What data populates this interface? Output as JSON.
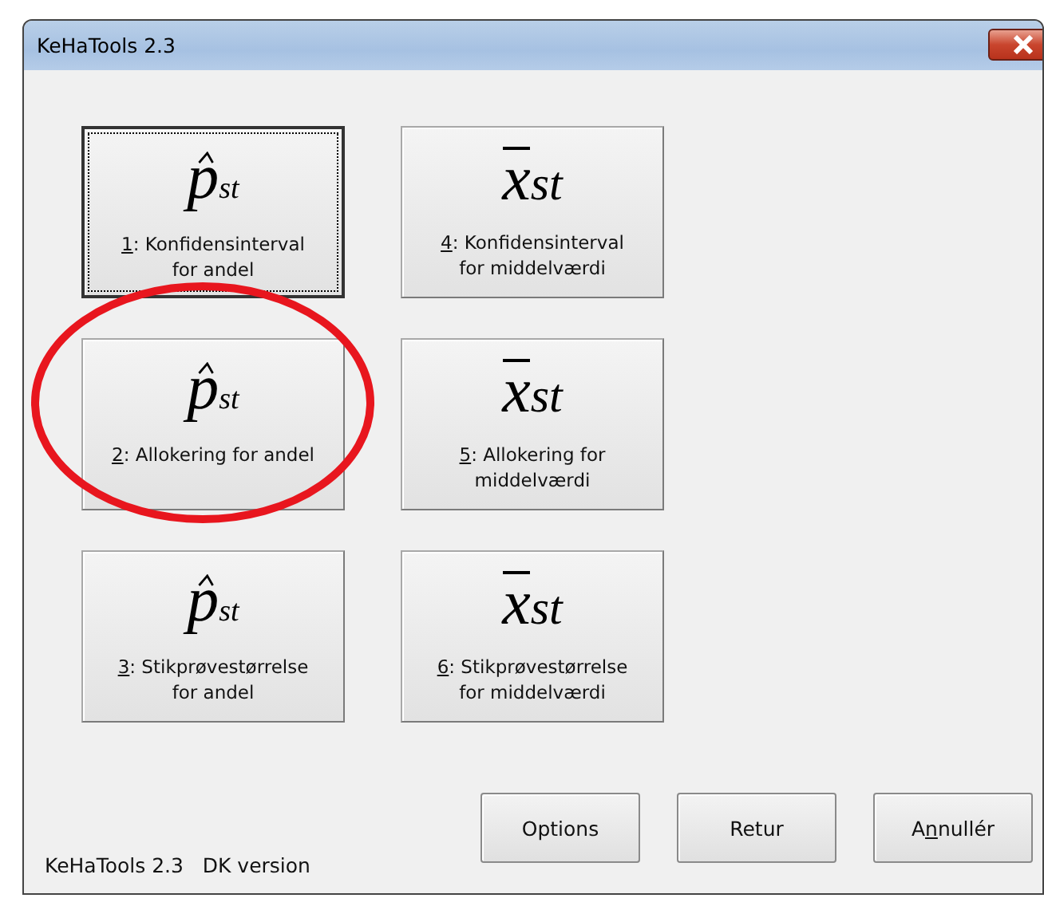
{
  "window": {
    "title": "KeHaTools 2.3"
  },
  "tiles": [
    {
      "kind": "hat",
      "base": "p",
      "sub": "st",
      "key": "1",
      "label": ": Konfidensinterval for andel",
      "focused": true,
      "circled": false
    },
    {
      "kind": "hat",
      "base": "p",
      "sub": "st",
      "key": "2",
      "label": ": Allokering for andel",
      "focused": false,
      "circled": true
    },
    {
      "kind": "hat",
      "base": "p",
      "sub": "st",
      "key": "3",
      "label": ": Stikprøvestørrelse for andel",
      "focused": false,
      "circled": false
    },
    {
      "kind": "bar",
      "base": "x",
      "sub": "st",
      "key": "4",
      "label": ": Konfidensinterval for middelværdi",
      "focused": false,
      "circled": false
    },
    {
      "kind": "bar",
      "base": "x",
      "sub": "st",
      "key": "5",
      "label": ": Allokering for middelværdi",
      "focused": false,
      "circled": false
    },
    {
      "kind": "bar",
      "base": "x",
      "sub": "st",
      "key": "6",
      "label": ": Stikprøvestørrelse for middelværdi",
      "focused": false,
      "circled": false
    }
  ],
  "footer_text": "KeHaTools 2.3   DK version",
  "buttons": [
    {
      "before": "Options"
    },
    {
      "before": "Retur"
    },
    {
      "before": "A",
      "key": "n",
      "after": "nullér"
    }
  ]
}
